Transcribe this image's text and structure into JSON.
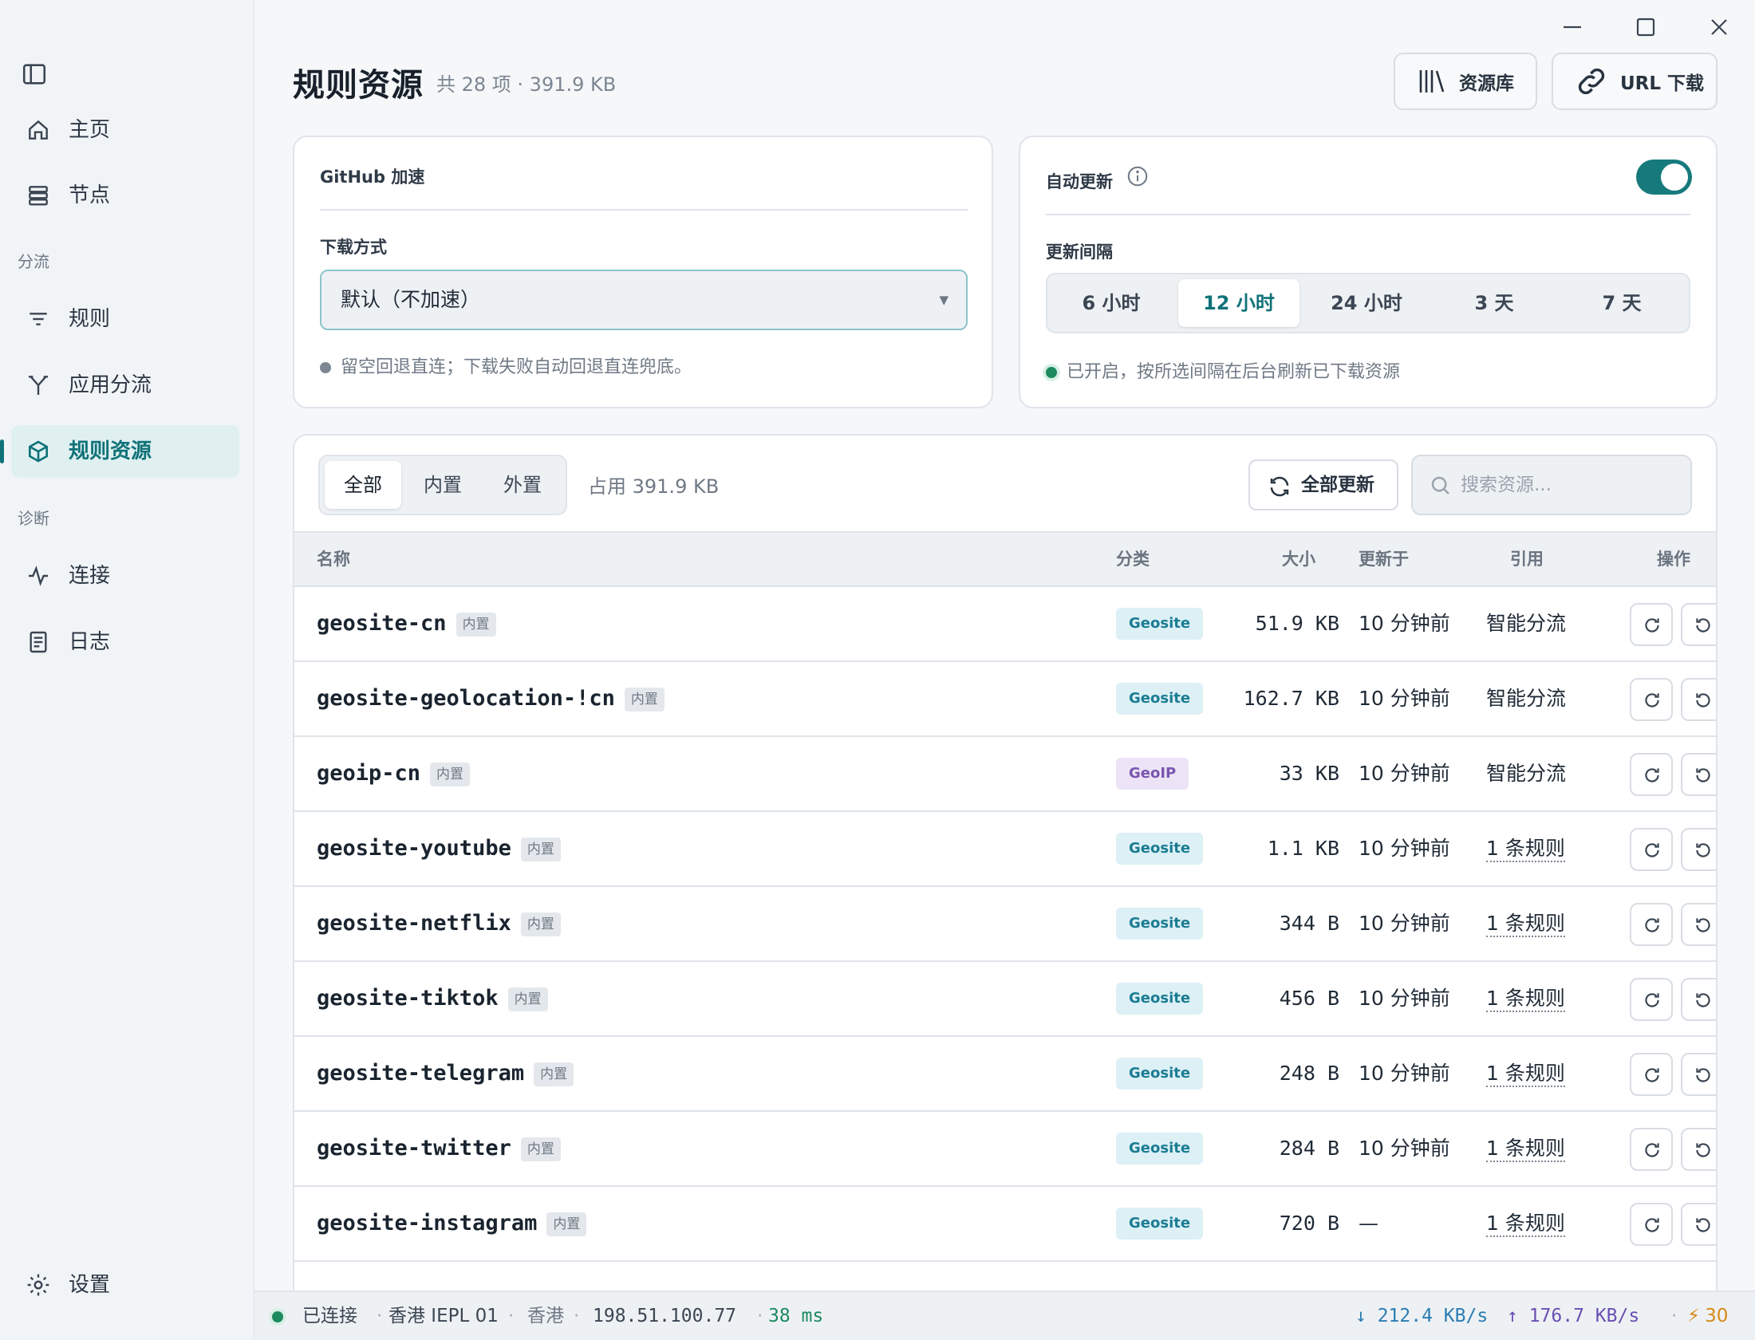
{
  "sidebar": {
    "items": [
      {
        "name": "sidebar-item-home",
        "icon": "home-icon",
        "label": "主页"
      },
      {
        "name": "sidebar-item-nodes",
        "icon": "server-icon",
        "label": "节点"
      },
      {
        "name": "sidebar-item-rules",
        "icon": "filter-icon",
        "label": "规则"
      },
      {
        "name": "sidebar-item-app-split",
        "icon": "split-icon",
        "label": "应用分流"
      },
      {
        "name": "sidebar-item-rule-resources",
        "icon": "box-icon",
        "label": "规则资源",
        "active": true
      },
      {
        "name": "sidebar-item-connections",
        "icon": "activity-icon",
        "label": "连接"
      },
      {
        "name": "sidebar-item-logs",
        "icon": "document-icon",
        "label": "日志"
      }
    ],
    "sections": [
      "分流",
      "诊断"
    ],
    "settings_label": "设置"
  },
  "header": {
    "title": "规则资源",
    "subtitle": "共 28 项 · 391.9 KB",
    "library_button": "资源库",
    "url_download_button": "URL 下载"
  },
  "github_card": {
    "title": "GitHub 加速",
    "download_label": "下载方式",
    "download_value": "默认（不加速）",
    "hint": "留空回退直连；下载失败自动回退直连兜底。"
  },
  "auto_update_card": {
    "title": "自动更新",
    "enabled": true,
    "interval_label": "更新间隔",
    "intervals": [
      "6 小时",
      "12 小时",
      "24 小时",
      "3 天",
      "7 天"
    ],
    "selected_interval": "12 小时",
    "hint": "已开启，按所选间隔在后台刷新已下载资源"
  },
  "resources": {
    "tabs": [
      "全部",
      "内置",
      "外置"
    ],
    "active_tab": "全部",
    "usage": "占用 391.9 KB",
    "update_all_button": "全部更新",
    "search_placeholder": "搜索资源...",
    "columns": {
      "name": "名称",
      "category": "分类",
      "size": "大小",
      "updated": "更新于",
      "ref": "引用",
      "actions": "操作"
    },
    "rows": [
      {
        "name": "geosite-cn",
        "tag": "内置",
        "category": "Geosite",
        "size": "51.9 KB",
        "updated": "10 分钟前",
        "ref": "智能分流",
        "ref_link": false
      },
      {
        "name": "geosite-geolocation-!cn",
        "tag": "内置",
        "category": "Geosite",
        "size": "162.7 KB",
        "updated": "10 分钟前",
        "ref": "智能分流",
        "ref_link": false
      },
      {
        "name": "geoip-cn",
        "tag": "内置",
        "category": "GeoIP",
        "size": "33 KB",
        "updated": "10 分钟前",
        "ref": "智能分流",
        "ref_link": false
      },
      {
        "name": "geosite-youtube",
        "tag": "内置",
        "category": "Geosite",
        "size": "1.1 KB",
        "updated": "10 分钟前",
        "ref": "1 条规则",
        "ref_link": true
      },
      {
        "name": "geosite-netflix",
        "tag": "内置",
        "category": "Geosite",
        "size": "344 B",
        "updated": "10 分钟前",
        "ref": "1 条规则",
        "ref_link": true
      },
      {
        "name": "geosite-tiktok",
        "tag": "内置",
        "category": "Geosite",
        "size": "456 B",
        "updated": "10 分钟前",
        "ref": "1 条规则",
        "ref_link": true
      },
      {
        "name": "geosite-telegram",
        "tag": "内置",
        "category": "Geosite",
        "size": "248 B",
        "updated": "10 分钟前",
        "ref": "1 条规则",
        "ref_link": true
      },
      {
        "name": "geosite-twitter",
        "tag": "内置",
        "category": "Geosite",
        "size": "284 B",
        "updated": "10 分钟前",
        "ref": "1 条规则",
        "ref_link": true
      },
      {
        "name": "geosite-instagram",
        "tag": "内置",
        "category": "Geosite",
        "size": "720 B",
        "updated": "—",
        "ref": "1 条规则",
        "ref_link": true
      }
    ]
  },
  "status_bar": {
    "connection": "已连接",
    "node": "香港 IEPL 01",
    "region": "香港",
    "ip": "198.51.100.77",
    "latency": "38 ms",
    "download": "212.4 KB/s",
    "upload": "176.7 KB/s",
    "connections": "30"
  },
  "colors": {
    "accent": "#0f7279",
    "success": "#1c8a5e",
    "download": "#2a7db3",
    "upload": "#6a4fb3",
    "warning": "#d68a16"
  }
}
